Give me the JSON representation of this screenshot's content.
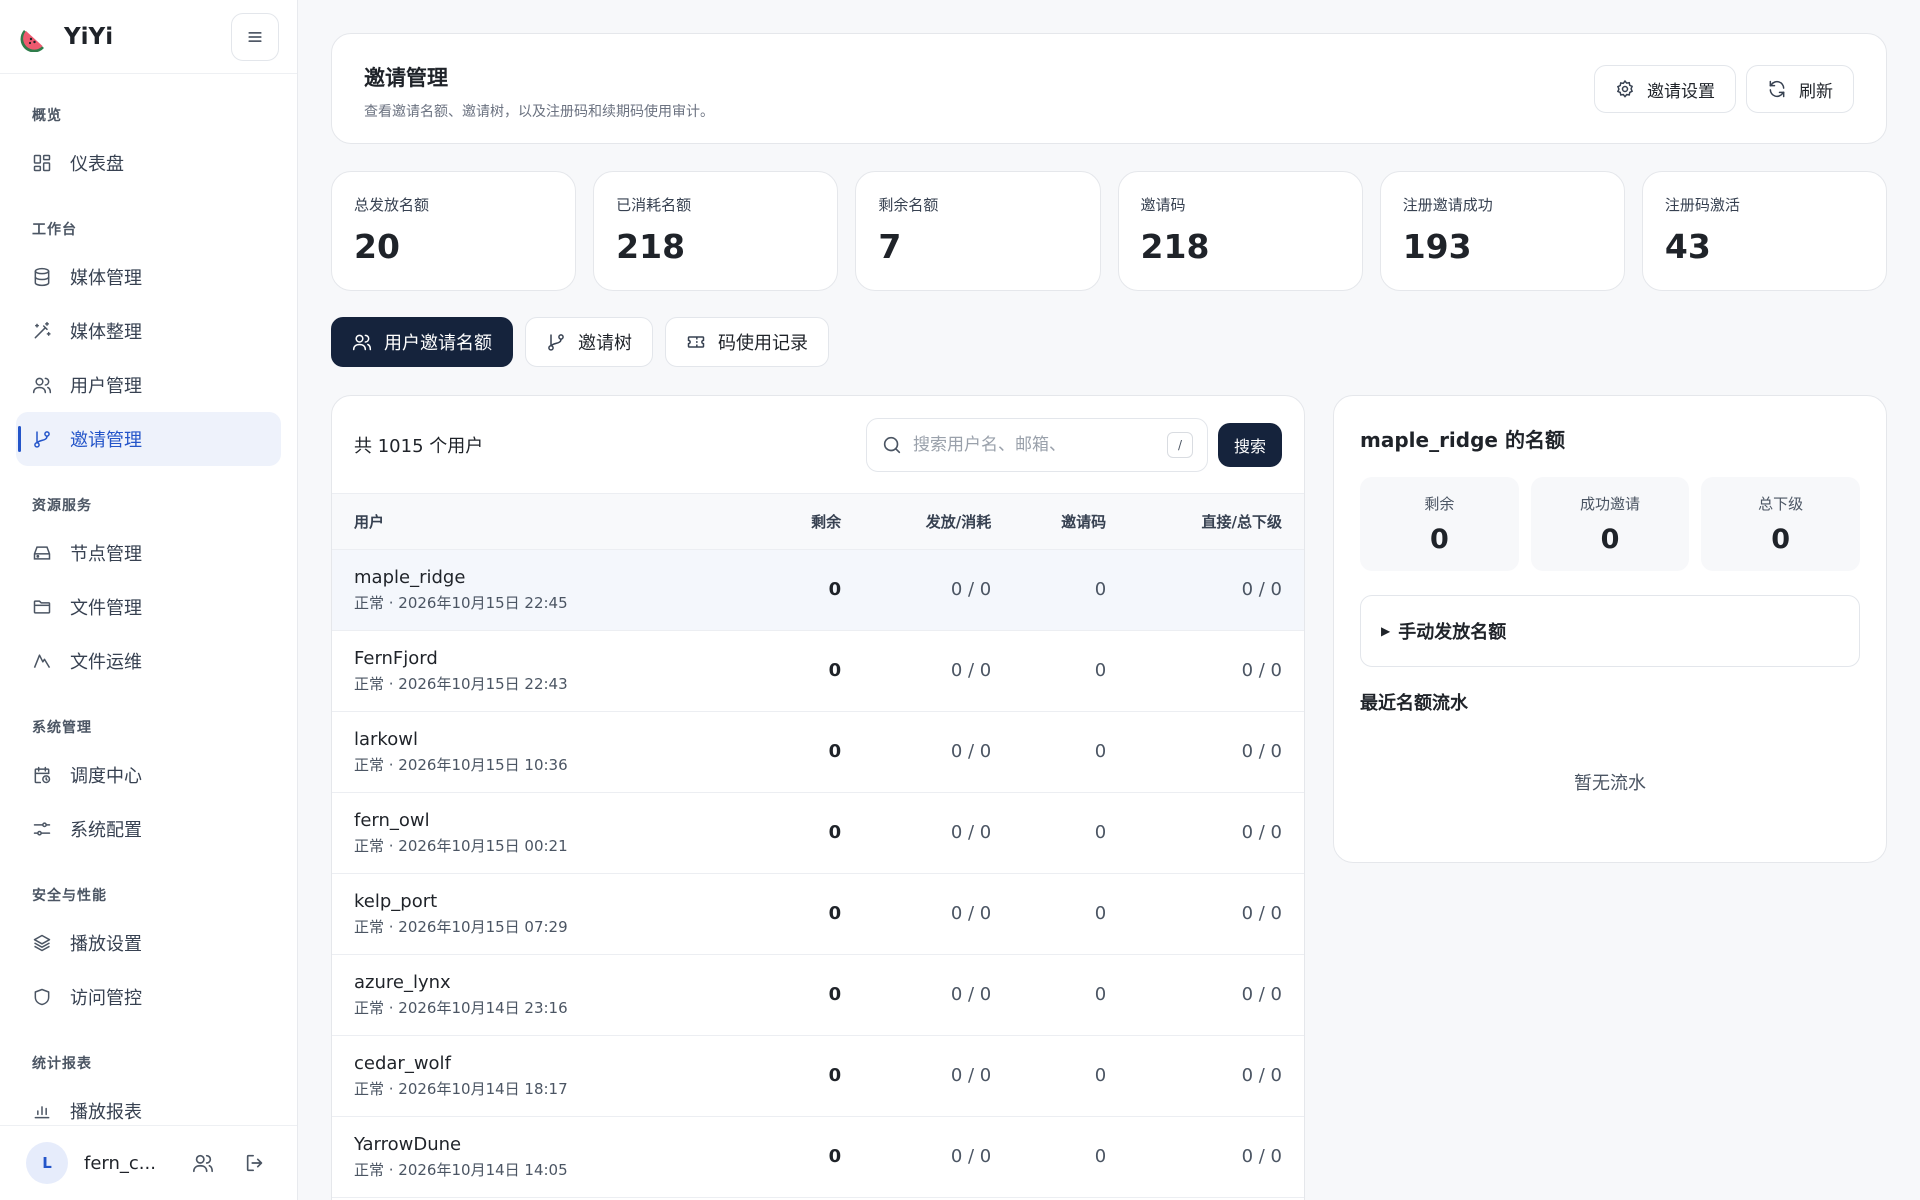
{
  "brand": {
    "name": "YiYi"
  },
  "sidebar": {
    "groups": [
      {
        "title": "概览",
        "items": [
          {
            "label": "仪表盘",
            "icon": "dashboard-icon"
          }
        ]
      },
      {
        "title": "工作台",
        "items": [
          {
            "label": "媒体管理",
            "icon": "database-icon"
          },
          {
            "label": "媒体整理",
            "icon": "magic-wand-icon"
          },
          {
            "label": "用户管理",
            "icon": "users-icon"
          },
          {
            "label": "邀请管理",
            "icon": "git-branch-icon",
            "active": true
          }
        ]
      },
      {
        "title": "资源服务",
        "items": [
          {
            "label": "节点管理",
            "icon": "hard-drive-icon"
          },
          {
            "label": "文件管理",
            "icon": "folder-icon"
          },
          {
            "label": "文件运维",
            "icon": "mountain-icon"
          }
        ]
      },
      {
        "title": "系统管理",
        "items": [
          {
            "label": "调度中心",
            "icon": "calendar-clock-icon"
          },
          {
            "label": "系统配置",
            "icon": "sliders-icon"
          }
        ]
      },
      {
        "title": "安全与性能",
        "items": [
          {
            "label": "播放设置",
            "icon": "layers-icon"
          },
          {
            "label": "访问管控",
            "icon": "shield-icon"
          }
        ]
      },
      {
        "title": "统计报表",
        "items": [
          {
            "label": "播放报表",
            "icon": "bar-chart-icon"
          }
        ]
      }
    ],
    "footer": {
      "avatar": "L",
      "username": "fern_c..."
    }
  },
  "header": {
    "title": "邀请管理",
    "description": "查看邀请名额、邀请树，以及注册码和续期码使用审计。",
    "settings_label": "邀请设置",
    "refresh_label": "刷新"
  },
  "stats": [
    {
      "label": "总发放名额",
      "value": "20"
    },
    {
      "label": "已消耗名额",
      "value": "218"
    },
    {
      "label": "剩余名额",
      "value": "7"
    },
    {
      "label": "邀请码",
      "value": "218"
    },
    {
      "label": "注册邀请成功",
      "value": "193"
    },
    {
      "label": "注册码激活",
      "value": "43"
    }
  ],
  "tabs": [
    {
      "label": "用户邀请名额",
      "icon": "users-icon",
      "active": true
    },
    {
      "label": "邀请树",
      "icon": "git-branch-icon"
    },
    {
      "label": "码使用记录",
      "icon": "ticket-icon"
    }
  ],
  "list": {
    "count_label": "共 1015 个用户",
    "search_placeholder": "搜索用户名、邮箱、",
    "search_value": "",
    "shortcut": "/",
    "search_button": "搜索",
    "columns": [
      "用户",
      "剩余",
      "发放/消耗",
      "邀请码",
      "直接/总下级"
    ],
    "rows": [
      {
        "name": "maple_ridge",
        "meta": "正常 · 2026年10月15日 22:45",
        "remaining": "0",
        "issued": "0 / 0",
        "codes": "0",
        "descendants": "0 / 0",
        "selected": true
      },
      {
        "name": "FernFjord",
        "meta": "正常 · 2026年10月15日 22:43",
        "remaining": "0",
        "issued": "0 / 0",
        "codes": "0",
        "descendants": "0 / 0"
      },
      {
        "name": "larkowl",
        "meta": "正常 · 2026年10月15日 10:36",
        "remaining": "0",
        "issued": "0 / 0",
        "codes": "0",
        "descendants": "0 / 0"
      },
      {
        "name": "fern_owl",
        "meta": "正常 · 2026年10月15日 00:21",
        "remaining": "0",
        "issued": "0 / 0",
        "codes": "0",
        "descendants": "0 / 0"
      },
      {
        "name": "kelp_port",
        "meta": "正常 · 2026年10月15日 07:29",
        "remaining": "0",
        "issued": "0 / 0",
        "codes": "0",
        "descendants": "0 / 0"
      },
      {
        "name": "azure_lynx",
        "meta": "正常 · 2026年10月14日 23:16",
        "remaining": "0",
        "issued": "0 / 0",
        "codes": "0",
        "descendants": "0 / 0"
      },
      {
        "name": "cedar_wolf",
        "meta": "正常 · 2026年10月14日 18:17",
        "remaining": "0",
        "issued": "0 / 0",
        "codes": "0",
        "descendants": "0 / 0"
      },
      {
        "name": "YarrowDune",
        "meta": "正常 · 2026年10月14日 14:05",
        "remaining": "0",
        "issued": "0 / 0",
        "codes": "0",
        "descendants": "0 / 0"
      }
    ]
  },
  "detail": {
    "title": "maple_ridge 的名额",
    "mini_stats": [
      {
        "label": "剩余",
        "value": "0"
      },
      {
        "label": "成功邀请",
        "value": "0"
      },
      {
        "label": "总下级",
        "value": "0"
      }
    ],
    "manual_issue_label": "手动发放名额",
    "recent_title": "最近名额流水",
    "empty_text": "暂无流水"
  },
  "colors": {
    "accent": "#2455c9",
    "dark_button": "#15233c",
    "active_bg": "#eef2fb"
  }
}
